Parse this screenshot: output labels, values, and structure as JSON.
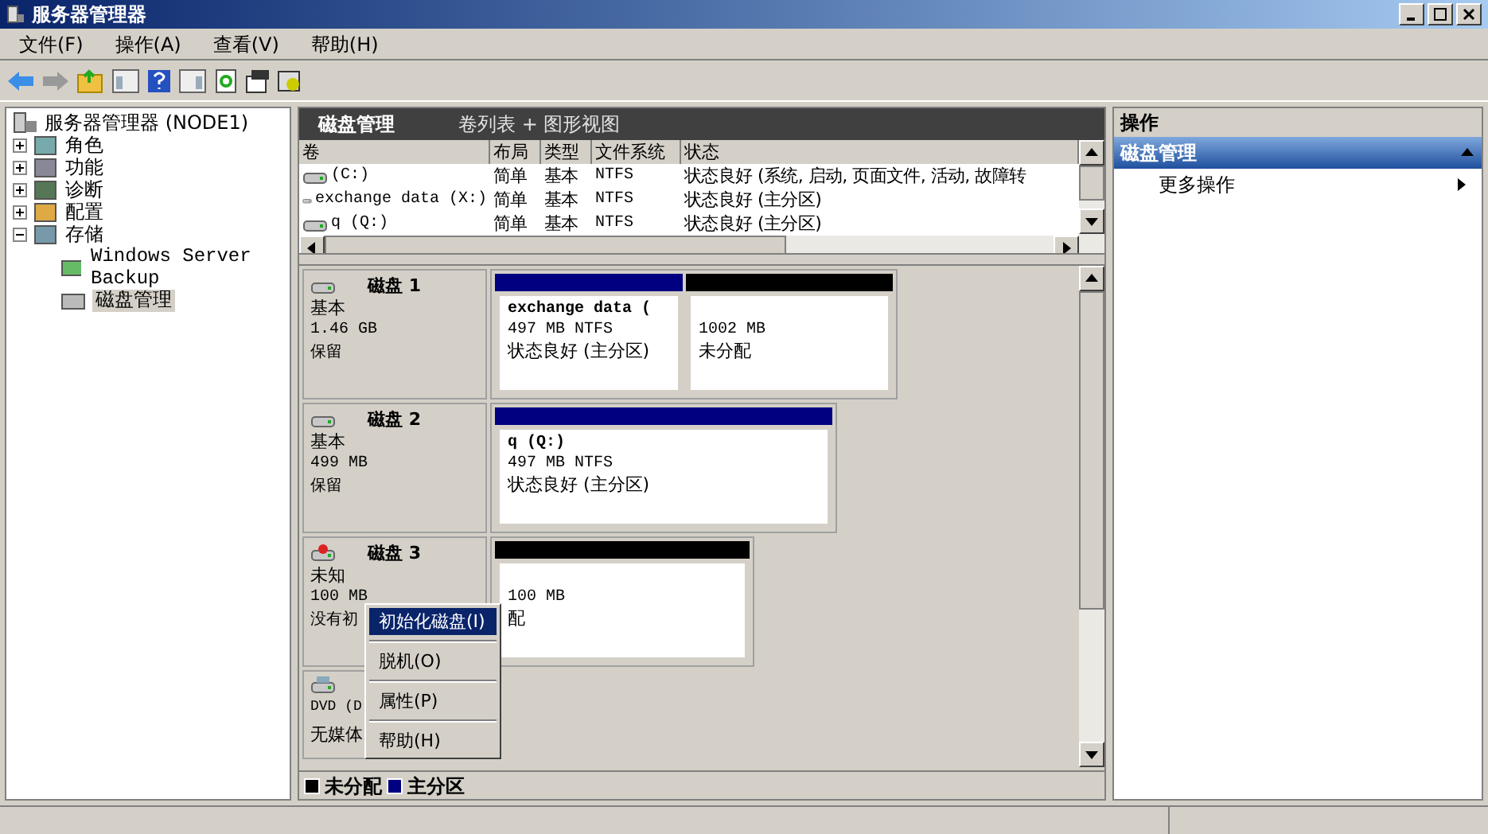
{
  "window": {
    "title": "服务器管理器"
  },
  "menu": [
    "文件(F)",
    "操作(A)",
    "查看(V)",
    "帮助(H)"
  ],
  "tree": {
    "label": "服务器管理器 (NODE1)",
    "children": [
      {
        "label": "角色",
        "expanded": false
      },
      {
        "label": "功能",
        "expanded": false
      },
      {
        "label": "诊断",
        "expanded": false
      },
      {
        "label": "配置",
        "expanded": false
      },
      {
        "label": "存储",
        "expanded": true,
        "children": [
          {
            "label": "Windows Server Backup",
            "selected": false
          },
          {
            "label": "磁盘管理",
            "selected": true
          }
        ]
      }
    ]
  },
  "header": {
    "title": "磁盘管理",
    "view": "卷列表 + 图形视图"
  },
  "table": {
    "columns": [
      "卷",
      "布局",
      "类型",
      "文件系统",
      "状态"
    ],
    "rows": [
      [
        "(C:)",
        "简单",
        "基本",
        "NTFS",
        "状态良好 (系统, 启动, 页面文件, 活动, 故障转"
      ],
      [
        "exchange data (X:)",
        "简单",
        "基本",
        "NTFS",
        "状态良好 (主分区)"
      ],
      [
        "q (Q:)",
        "简单",
        "基本",
        "NTFS",
        "状态良好 (主分区)"
      ]
    ]
  },
  "disks": [
    {
      "name": "磁盘 1",
      "kind": "basic",
      "type": "基本",
      "size": "1.46 GB",
      "status": "保留",
      "partitions": [
        {
          "kind": "primary",
          "name": "exchange data (",
          "size": "497 MB NTFS",
          "status": "状态良好 (主分区)"
        },
        {
          "kind": "unallocated",
          "size": "1002 MB",
          "status": "未分配"
        }
      ]
    },
    {
      "name": "磁盘 2",
      "kind": "basic",
      "type": "基本",
      "size": "499 MB",
      "status": "保留",
      "partitions": [
        {
          "kind": "primary",
          "name": "q  (Q:)",
          "size": "497 MB NTFS",
          "status": "状态良好 (主分区)"
        }
      ]
    },
    {
      "name": "磁盘 3",
      "kind": "unknown",
      "type": "未知",
      "size": "100 MB",
      "status": "没有初",
      "partitions": [
        {
          "kind": "unallocated",
          "size": "100 MB",
          "status": "配"
        }
      ]
    },
    {
      "name": "DVD (D",
      "kind": "dvd",
      "type": "无媒体"
    }
  ],
  "legend": [
    {
      "label": "未分配",
      "color": "#000000"
    },
    {
      "label": "主分区",
      "color": "#000080"
    }
  ],
  "context_menu": [
    {
      "label": "初始化磁盘(I)",
      "selected": true
    },
    {
      "label": "脱机(O)",
      "selected": false
    },
    {
      "label": "属性(P)",
      "selected": false
    },
    {
      "label": "帮助(H)",
      "selected": false
    }
  ],
  "actions": {
    "title": "操作",
    "section": "磁盘管理",
    "items": [
      "更多操作"
    ]
  }
}
